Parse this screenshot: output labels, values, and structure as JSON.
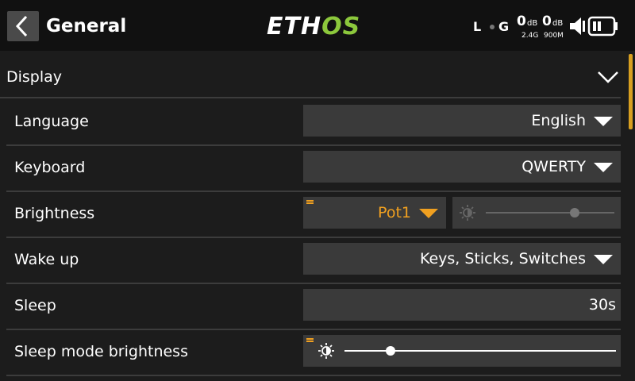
{
  "header": {
    "title": "General",
    "logo_left": "ETH",
    "logo_right": "OS",
    "status": {
      "l_label": "L",
      "g_label": "G",
      "rssi_24": "0",
      "rssi_24_unit": "dB",
      "rssi_24_band": "2.4G",
      "rssi_900": "0",
      "rssi_900_unit": "dB",
      "rssi_900_band": "900M"
    }
  },
  "section": {
    "label": "Display",
    "expanded": true
  },
  "rows": {
    "language": {
      "label": "Language",
      "value": "English"
    },
    "keyboard": {
      "label": "Keyboard",
      "value": "QWERTY"
    },
    "brightness": {
      "label": "Brightness",
      "source": "Pot1",
      "slider_level": 0.69
    },
    "wakeup": {
      "label": "Wake up",
      "value": "Keys, Sticks, Switches"
    },
    "sleep": {
      "label": "Sleep",
      "value": "30s"
    },
    "sleep_brightness": {
      "label": "Sleep mode brightness",
      "slider_level": 0.17
    }
  },
  "colors": {
    "accent": "#f0a020",
    "brand_green": "#8cc83c",
    "background": "#1c1c1c",
    "field": "#3a3a3a"
  }
}
